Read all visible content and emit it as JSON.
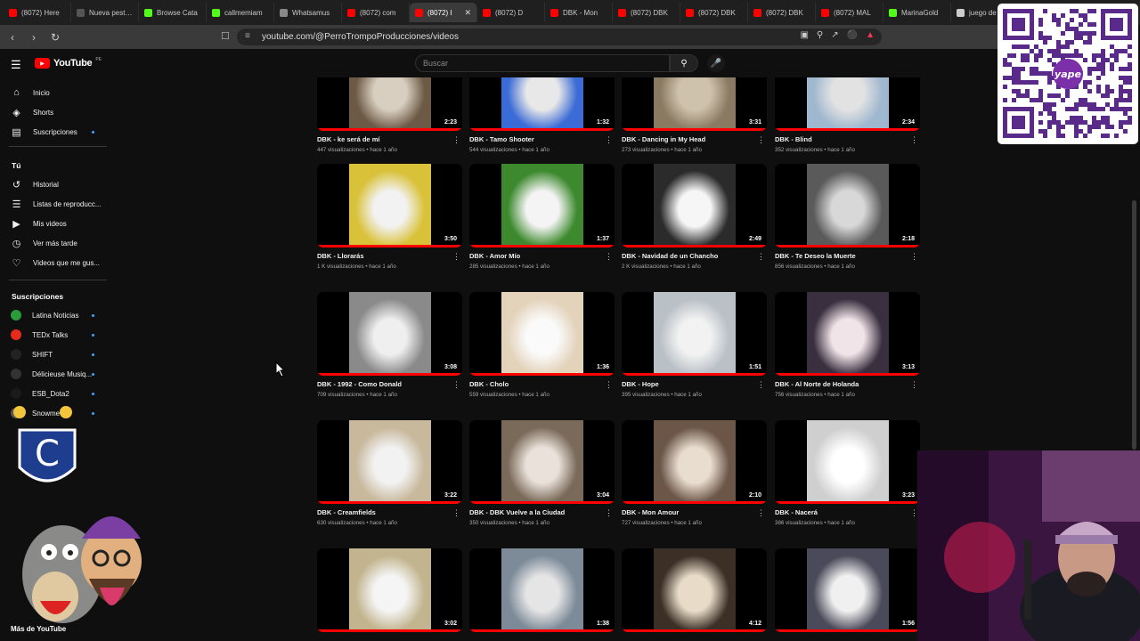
{
  "browser": {
    "tabs": [
      {
        "label": "(8072) Here",
        "color": "#ff0000"
      },
      {
        "label": "Nueva pestaña",
        "color": "#555555"
      },
      {
        "label": "Browse Cata",
        "color": "#53fc18"
      },
      {
        "label": "callmemiam",
        "color": "#53fc18"
      },
      {
        "label": "Whatsamus",
        "color": "#888888"
      },
      {
        "label": "(8072) com",
        "color": "#ff0000"
      },
      {
        "label": "(8072) I",
        "color": "#ff0000",
        "active": true
      },
      {
        "label": "(8072) D",
        "color": "#ff0000"
      },
      {
        "label": "DBK - Mon",
        "color": "#ff0000"
      },
      {
        "label": "(8072) DBK",
        "color": "#ff0000"
      },
      {
        "label": "(8072) DBK",
        "color": "#ff0000"
      },
      {
        "label": "(8072) DBK",
        "color": "#ff0000"
      },
      {
        "label": "(8072) MAL",
        "color": "#ff0000"
      },
      {
        "label": "MarinaGold",
        "color": "#53fc18"
      },
      {
        "label": "juego de",
        "color": "#cccccc"
      }
    ],
    "url": "youtube.com/@PerroTrompoProducciones/videos"
  },
  "header": {
    "logo_text": "YouTube",
    "country": "PE",
    "search_placeholder": "Buscar"
  },
  "sidebar": {
    "main": [
      {
        "label": "Inicio",
        "icon": "home-icon"
      },
      {
        "label": "Shorts",
        "icon": "shorts-icon"
      },
      {
        "label": "Suscripciones",
        "icon": "subscriptions-icon"
      }
    ],
    "you_heading": "Tú",
    "you": [
      {
        "label": "Historial",
        "icon": "history-icon"
      },
      {
        "label": "Listas de reproducc...",
        "icon": "playlist-icon"
      },
      {
        "label": "Mis videos",
        "icon": "video-icon"
      },
      {
        "label": "Ver más tarde",
        "icon": "clock-icon"
      },
      {
        "label": "Videos que me gus...",
        "icon": "like-icon"
      }
    ],
    "subs_heading": "Suscripciones",
    "subs": [
      {
        "label": "Latina Noticias",
        "color": "#2a9d3a"
      },
      {
        "label": "TEDx Talks",
        "color": "#e62b1e"
      },
      {
        "label": "SHIFT",
        "color": "#222222"
      },
      {
        "label": "Délicieuse Musiq...",
        "color": "#333333"
      },
      {
        "label": "ESB_Dota2",
        "color": "#1a1a1a"
      },
      {
        "label": "Snowme",
        "color": "#555555"
      }
    ],
    "more_label": "Más de YouTube"
  },
  "videos": [
    {
      "title": "DBK - ke será de mí",
      "views": "447 visualizaciones",
      "age": "hace 1 año",
      "duration": "2:23"
    },
    {
      "title": "DBK - Tamo Shooter",
      "views": "544 visualizaciones",
      "age": "hace 1 año",
      "duration": "1:32"
    },
    {
      "title": "DBK - Dancing in My Head",
      "views": "273 visualizaciones",
      "age": "hace 1 año",
      "duration": "3:31"
    },
    {
      "title": "DBK - Blind",
      "views": "352 visualizaciones",
      "age": "hace 1 año",
      "duration": "2:34"
    },
    {
      "title": "DBK - Llorarás",
      "views": "1 K visualizaciones",
      "age": "hace 1 año",
      "duration": "3:50"
    },
    {
      "title": "DBK - Amor Mío",
      "views": "285 visualizaciones",
      "age": "hace 1 año",
      "duration": "1:37"
    },
    {
      "title": "DBK - Navidad de un Chancho",
      "views": "2 K visualizaciones",
      "age": "hace 1 año",
      "duration": "2:49"
    },
    {
      "title": "DBK - Te Deseo la Muerte",
      "views": "856 visualizaciones",
      "age": "hace 1 año",
      "duration": "2:18"
    },
    {
      "title": "DBK - 1992 - Como Donald",
      "views": "709 visualizaciones",
      "age": "hace 1 año",
      "duration": "3:08"
    },
    {
      "title": "DBK - Cholo",
      "views": "559 visualizaciones",
      "age": "hace 1 año",
      "duration": "1:36"
    },
    {
      "title": "DBK - Hope",
      "views": "395 visualizaciones",
      "age": "hace 1 año",
      "duration": "1:51"
    },
    {
      "title": "DBK - Al Norte de Holanda",
      "views": "756 visualizaciones",
      "age": "hace 1 año",
      "duration": "3:13"
    },
    {
      "title": "DBK - Creamfields",
      "views": "630 visualizaciones",
      "age": "hace 1 año",
      "duration": "3:22"
    },
    {
      "title": "DBK - DBK Vuelve a la Ciudad",
      "views": "350 visualizaciones",
      "age": "hace 1 año",
      "duration": "3:04"
    },
    {
      "title": "DBK - Mon Amour",
      "views": "727 visualizaciones",
      "age": "hace 1 año",
      "duration": "2:10"
    },
    {
      "title": "DBK - Nacerá",
      "views": "386 visualizaciones",
      "age": "hace 1 año",
      "duration": "3:23"
    },
    {
      "title": "",
      "views": "",
      "age": "",
      "duration": "3:02"
    },
    {
      "title": "",
      "views": "",
      "age": "",
      "duration": "1:38"
    },
    {
      "title": "",
      "views": "",
      "age": "",
      "duration": "4:12"
    },
    {
      "title": "",
      "views": "",
      "age": "",
      "duration": "1:56"
    }
  ],
  "overlay": {
    "qr_label": "yape"
  },
  "colors": {
    "accent": "#ff0000",
    "bg": "#0f0f0f",
    "link": "#3ea6ff"
  }
}
